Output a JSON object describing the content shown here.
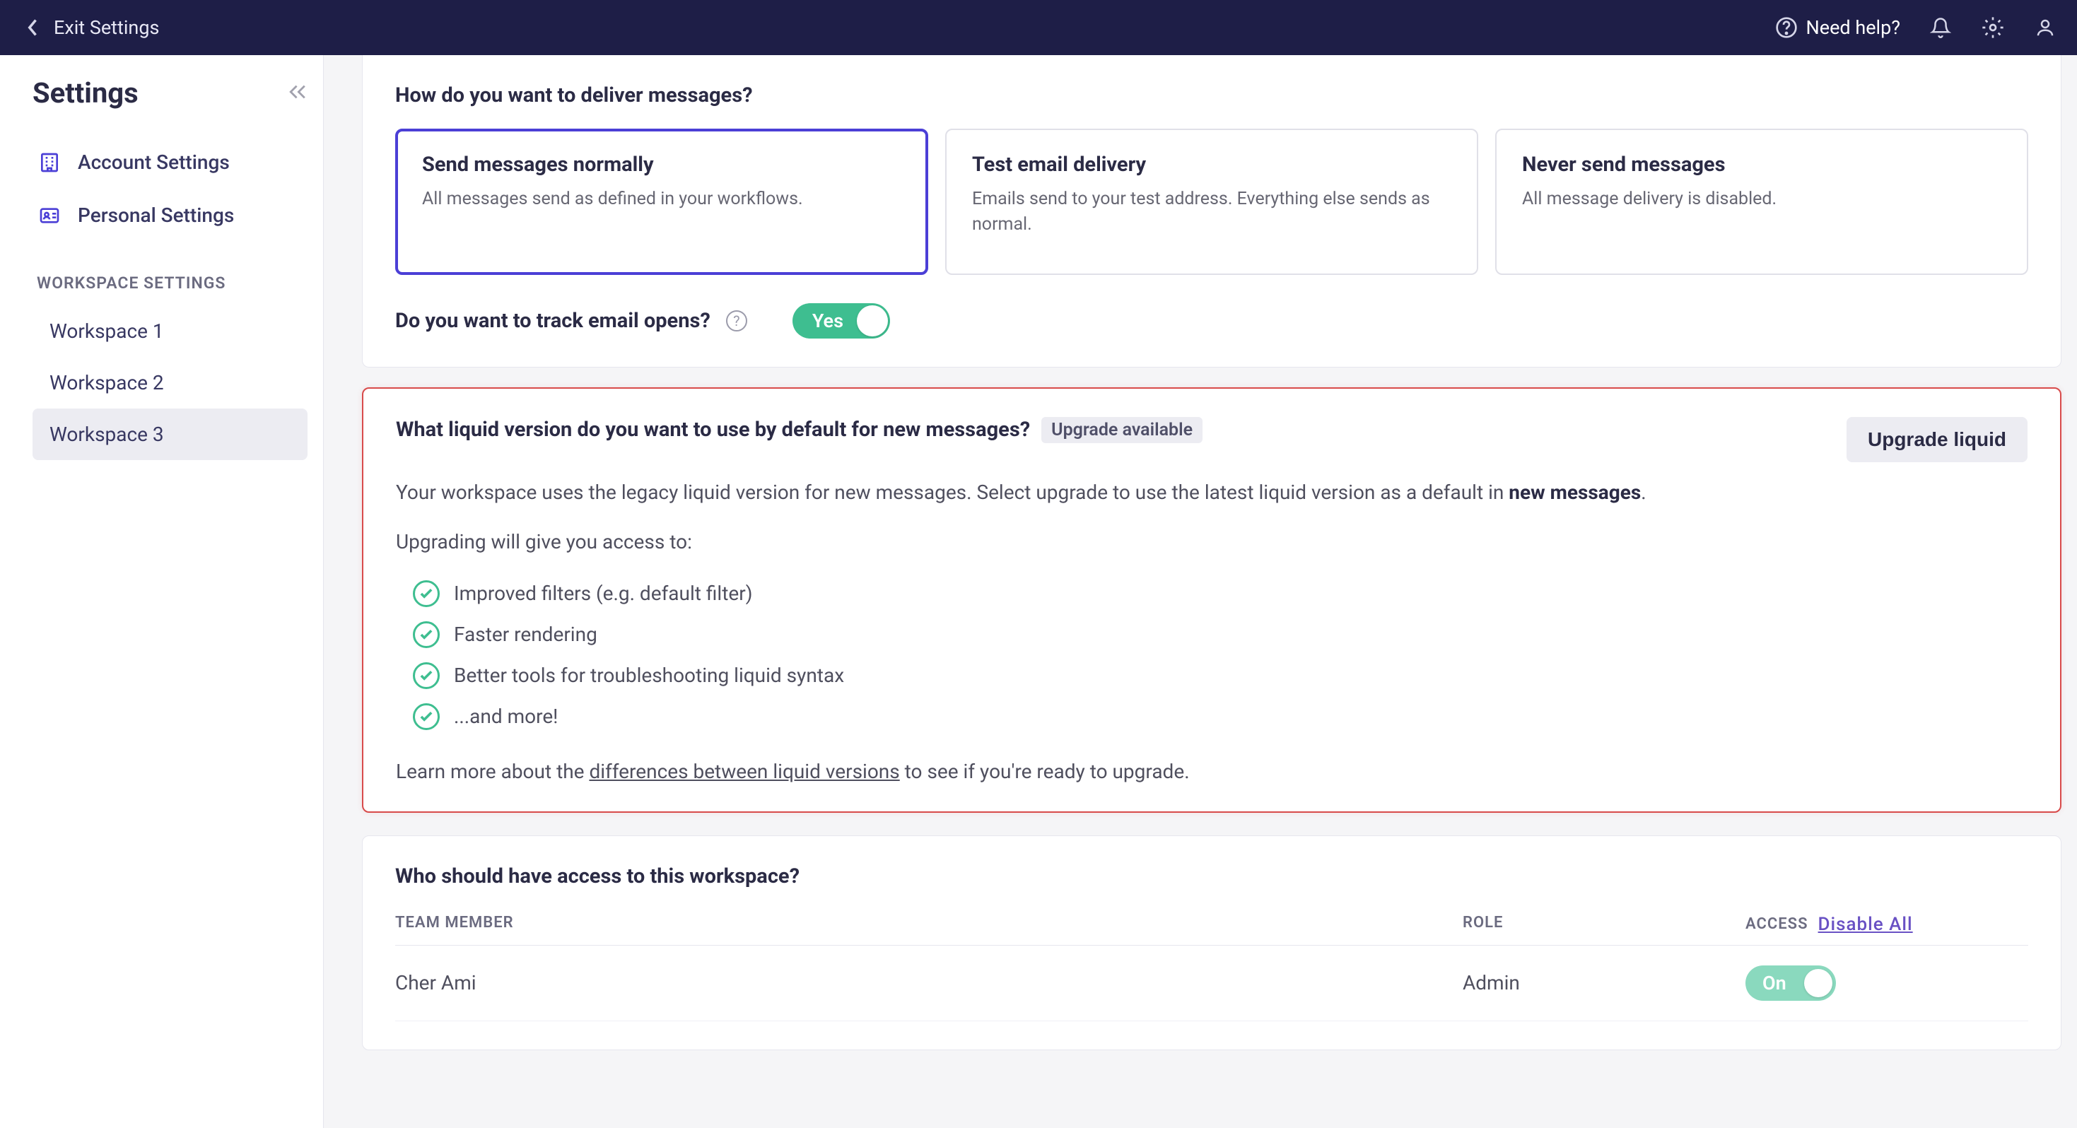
{
  "topbar": {
    "exit_label": "Exit Settings",
    "help_label": "Need help?"
  },
  "sidebar": {
    "title": "Settings",
    "account_label": "Account Settings",
    "personal_label": "Personal Settings",
    "section_label": "WORKSPACE SETTINGS",
    "workspaces": [
      "Workspace 1",
      "Workspace 2",
      "Workspace 3"
    ]
  },
  "deliver": {
    "heading": "How do you want to deliver messages?",
    "options": [
      {
        "title": "Send messages normally",
        "desc": "All messages send as defined in your workflows."
      },
      {
        "title": "Test email delivery",
        "desc": "Emails send to your test address. Everything else sends as normal."
      },
      {
        "title": "Never send messages",
        "desc": "All message delivery is disabled."
      }
    ],
    "track_question": "Do you want to track email opens?",
    "track_toggle": "Yes"
  },
  "liquid": {
    "heading": "What liquid version do you want to use by default for new messages?",
    "badge": "Upgrade available",
    "upgrade_btn": "Upgrade liquid",
    "desc_pre": "Your workspace uses the legacy liquid version for new messages. Select upgrade to use the latest liquid version as a default in ",
    "desc_strong": "new messages",
    "desc_post": ".",
    "sub": "Upgrading will give you access to:",
    "benefits": [
      "Improved filters (e.g. default filter)",
      "Faster rendering",
      "Better tools for troubleshooting liquid syntax",
      "...and more!"
    ],
    "learn_pre": "Learn more about the ",
    "learn_link": "differences between liquid versions",
    "learn_post": " to see if you're ready to upgrade."
  },
  "access": {
    "heading": "Who should have access to this workspace?",
    "th_member": "TEAM MEMBER",
    "th_role": "ROLE",
    "th_access": "ACCESS",
    "disable_all": "Disable All",
    "rows": [
      {
        "name": "Cher Ami",
        "role": "Admin",
        "toggle": "On"
      }
    ]
  }
}
